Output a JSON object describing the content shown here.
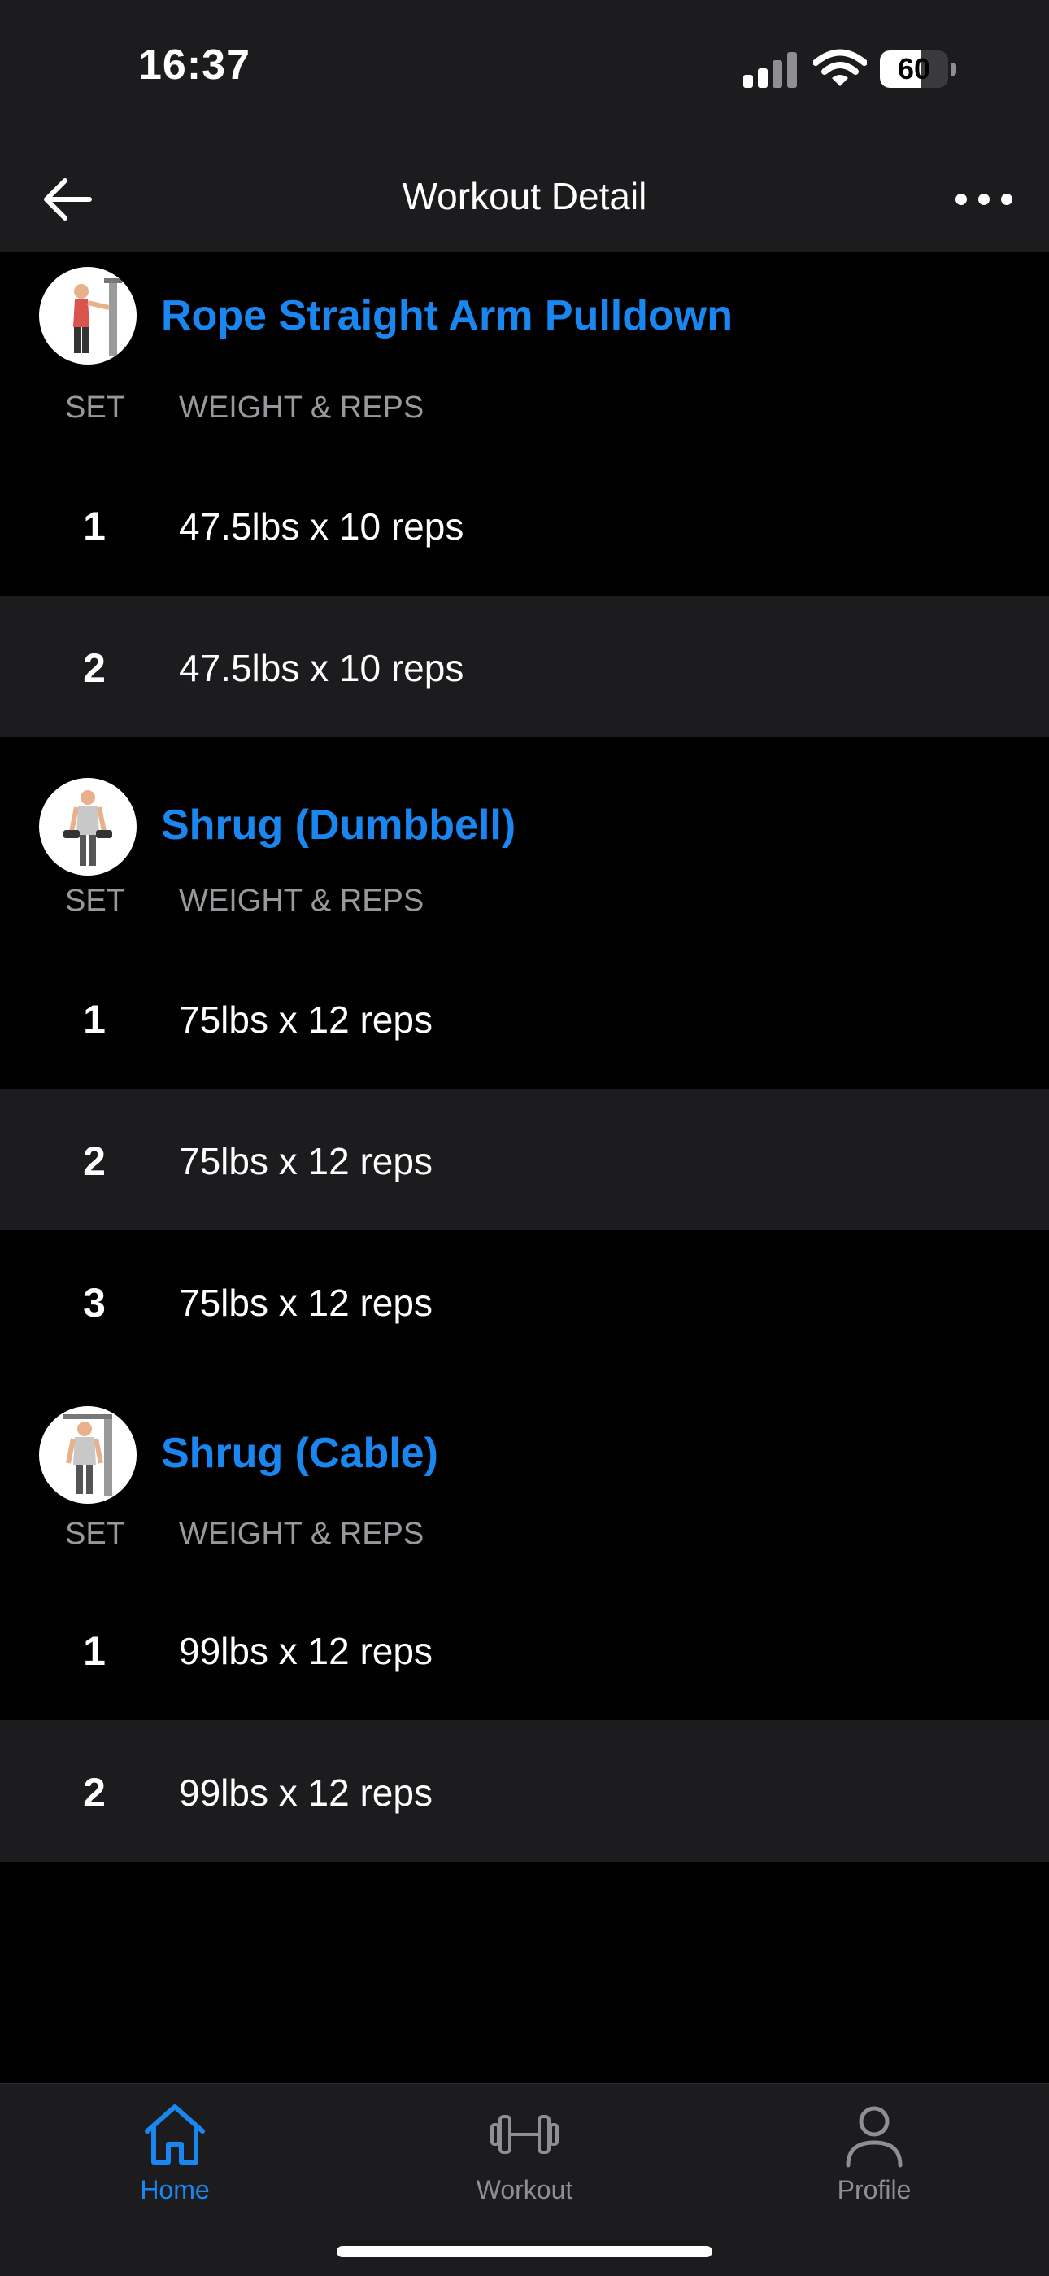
{
  "status_bar": {
    "time": "16:37",
    "battery_level": "60",
    "battery_fraction": 0.6,
    "icons": [
      "signal-icon",
      "wifi-icon",
      "battery-icon"
    ]
  },
  "nav": {
    "title": "Workout Detail",
    "back_icon": "arrow-left-icon",
    "more_icon": "more-horizontal-icon"
  },
  "colors": {
    "accent": "#1a86f0",
    "background": "#000000",
    "surface": "#1c1c1e",
    "muted_text": "#98989d"
  },
  "exercises": [
    {
      "name": "Rope Straight Arm Pulldown",
      "set_header": "SET",
      "weight_reps_header": "WEIGHT & REPS",
      "sets": [
        {
          "num": "1",
          "value": "47.5lbs x 10 reps"
        },
        {
          "num": "2",
          "value": "47.5lbs x 10 reps"
        }
      ]
    },
    {
      "name": "Shrug (Dumbbell)",
      "set_header": "SET",
      "weight_reps_header": "WEIGHT & REPS",
      "sets": [
        {
          "num": "1",
          "value": "75lbs x 12 reps"
        },
        {
          "num": "2",
          "value": "75lbs x 12 reps"
        },
        {
          "num": "3",
          "value": "75lbs x 12 reps"
        }
      ]
    },
    {
      "name": "Shrug (Cable)",
      "set_header": "SET",
      "weight_reps_header": "WEIGHT & REPS",
      "sets": [
        {
          "num": "1",
          "value": "99lbs x 12 reps"
        },
        {
          "num": "2",
          "value": "99lbs x 12 reps"
        }
      ]
    }
  ],
  "tab_bar": {
    "tabs": [
      {
        "label": "Home",
        "icon": "home-icon",
        "active": true
      },
      {
        "label": "Workout",
        "icon": "dumbbell-icon",
        "active": false
      },
      {
        "label": "Profile",
        "icon": "profile-icon",
        "active": false
      }
    ]
  }
}
